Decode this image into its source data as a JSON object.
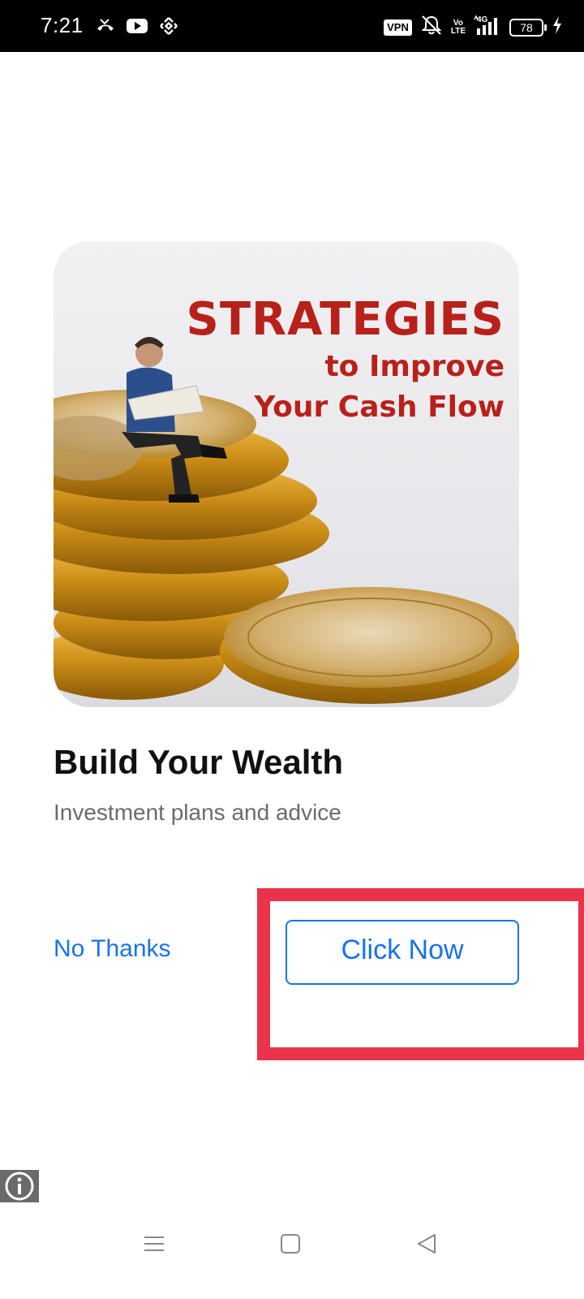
{
  "status_bar": {
    "time": "7:21",
    "vpn_label": "VPN",
    "volte_label": "Vo\nLTE",
    "network_label": "4G",
    "battery_level": "78",
    "left_icons": [
      "missed-call-icon",
      "youtube-icon",
      "binance-icon"
    ],
    "right_icons": [
      "vpn-icon",
      "mute-icon",
      "volte-icon",
      "signal-icon",
      "battery-icon",
      "charging-icon"
    ]
  },
  "ad": {
    "image_text": {
      "line1": "STRATEGIES",
      "line2": "to Improve",
      "line3": "Your Cash Flow"
    },
    "title": "Build Your Wealth",
    "subtitle": "Investment plans and advice",
    "dismiss_label": "No Thanks",
    "cta_label": "Click Now",
    "info_icon": "info-icon"
  },
  "nav_bar": {
    "buttons": [
      "menu-icon",
      "home-icon",
      "back-icon"
    ]
  },
  "colors": {
    "accent": "#1a73e8",
    "highlight": "#e8334a",
    "headline_red": "#b8211a"
  }
}
